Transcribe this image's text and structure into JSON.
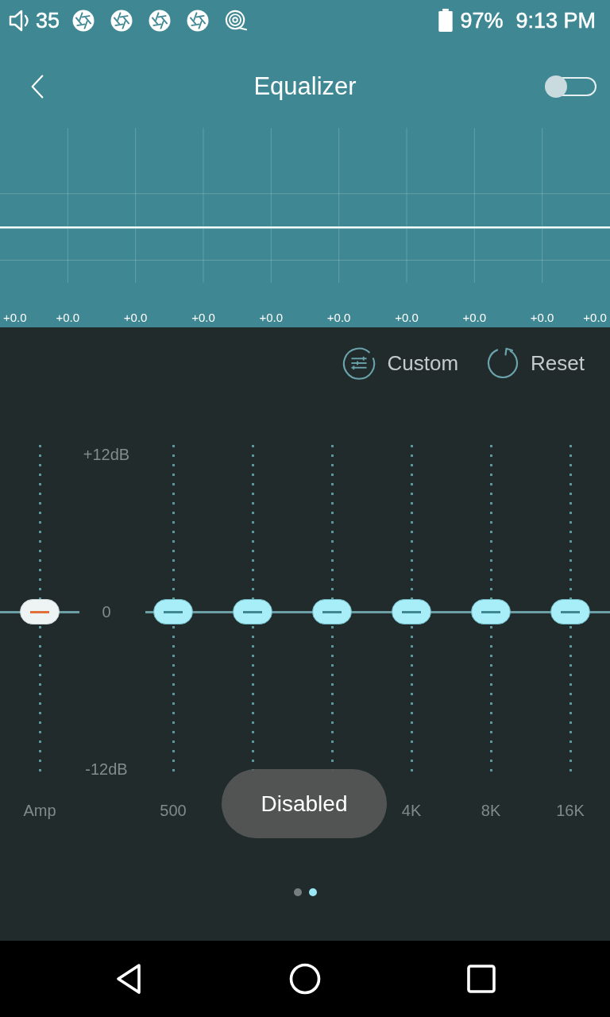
{
  "status_bar": {
    "volume": "35",
    "battery": "97%",
    "time": "9:13 PM"
  },
  "header": {
    "title": "Equalizer",
    "toggle": {
      "on": false
    }
  },
  "graph": {
    "readings": [
      "+0.0",
      "+0.0",
      "+0.0",
      "+0.0",
      "+0.0",
      "+0.0",
      "+0.0",
      "+0.0",
      "+0.0",
      "+0.0"
    ]
  },
  "actions": [
    {
      "kind": "custom",
      "label": "Custom"
    },
    {
      "kind": "reset",
      "label": "Reset"
    }
  ],
  "scale": {
    "top": "+12dB",
    "zero": "0",
    "bottom": "-12dB"
  },
  "amp": {
    "label": "Amp",
    "level": 0.5
  },
  "bands": [
    {
      "label": "500",
      "level": 0.5
    },
    {
      "level": 0.5
    },
    {
      "level": 0.5
    },
    {
      "label": "4K",
      "level": 0.5
    },
    {
      "label": "8K",
      "level": 0.5
    },
    {
      "label": "16K",
      "level": 0.5
    }
  ],
  "toast": {
    "text": "Disabled"
  },
  "pager": [
    {
      "selected": false
    },
    {
      "selected": true
    }
  ]
}
